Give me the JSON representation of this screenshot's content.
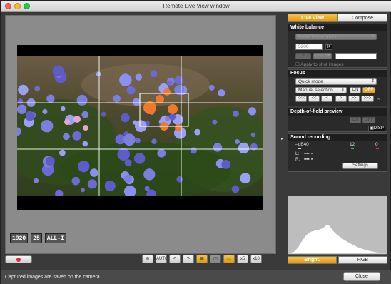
{
  "window": {
    "title": "Remote Live View window"
  },
  "left": {
    "format_icons": [
      "1920",
      "25",
      "ALL-I"
    ],
    "toolbar": [
      {
        "name": "crosshair-button",
        "glyph": "⊕"
      },
      {
        "name": "auto-focus-button",
        "glyph": "AUTO"
      },
      {
        "name": "rotate-left-button",
        "glyph": "↶"
      },
      {
        "name": "rotate-right-button",
        "glyph": "↷"
      },
      {
        "name": "grid-button",
        "glyph": "▦"
      },
      {
        "name": "compare-button",
        "glyph": "◫"
      },
      {
        "name": "zoom-fit-button",
        "glyph": "▭"
      },
      {
        "name": "zoom-x5-button",
        "glyph": "x5"
      },
      {
        "name": "zoom-x10-button",
        "glyph": "x10"
      }
    ]
  },
  "panel": {
    "tabs": {
      "live_view": "Live View",
      "compose": "Compose"
    },
    "white_balance": {
      "header": "White balance",
      "mode": "Color Temperature",
      "temperature_value": "5200",
      "unit": "K",
      "apply_label": "Apply to shot images"
    },
    "focus": {
      "header": "Focus",
      "mode": "Quick mode",
      "selection": "Manual selection",
      "on_label": "ON",
      "off_label": "OFF",
      "nav": [
        "<<<",
        "<<",
        "<",
        ">",
        ">>",
        ">>>",
        "∞"
      ]
    },
    "dof": {
      "header": "Depth-of-field preview",
      "on_label": "ON",
      "off_label": "OFF",
      "disp_label": "DISP"
    },
    "sound": {
      "header": "Sound recording",
      "db_label": "–dB40",
      "mark_12": "12",
      "mark_0": "0",
      "l_label": "L:",
      "r_label": "R:",
      "settings_label": "Settings"
    },
    "histogram": {
      "bright_label": "Bright.",
      "rgb_label": "RGB"
    }
  },
  "status": {
    "message": "Captured images are saved on the camera.",
    "close_label": "Close"
  },
  "colors": {
    "accent": "#f0a81e",
    "recording": "#e23333"
  }
}
